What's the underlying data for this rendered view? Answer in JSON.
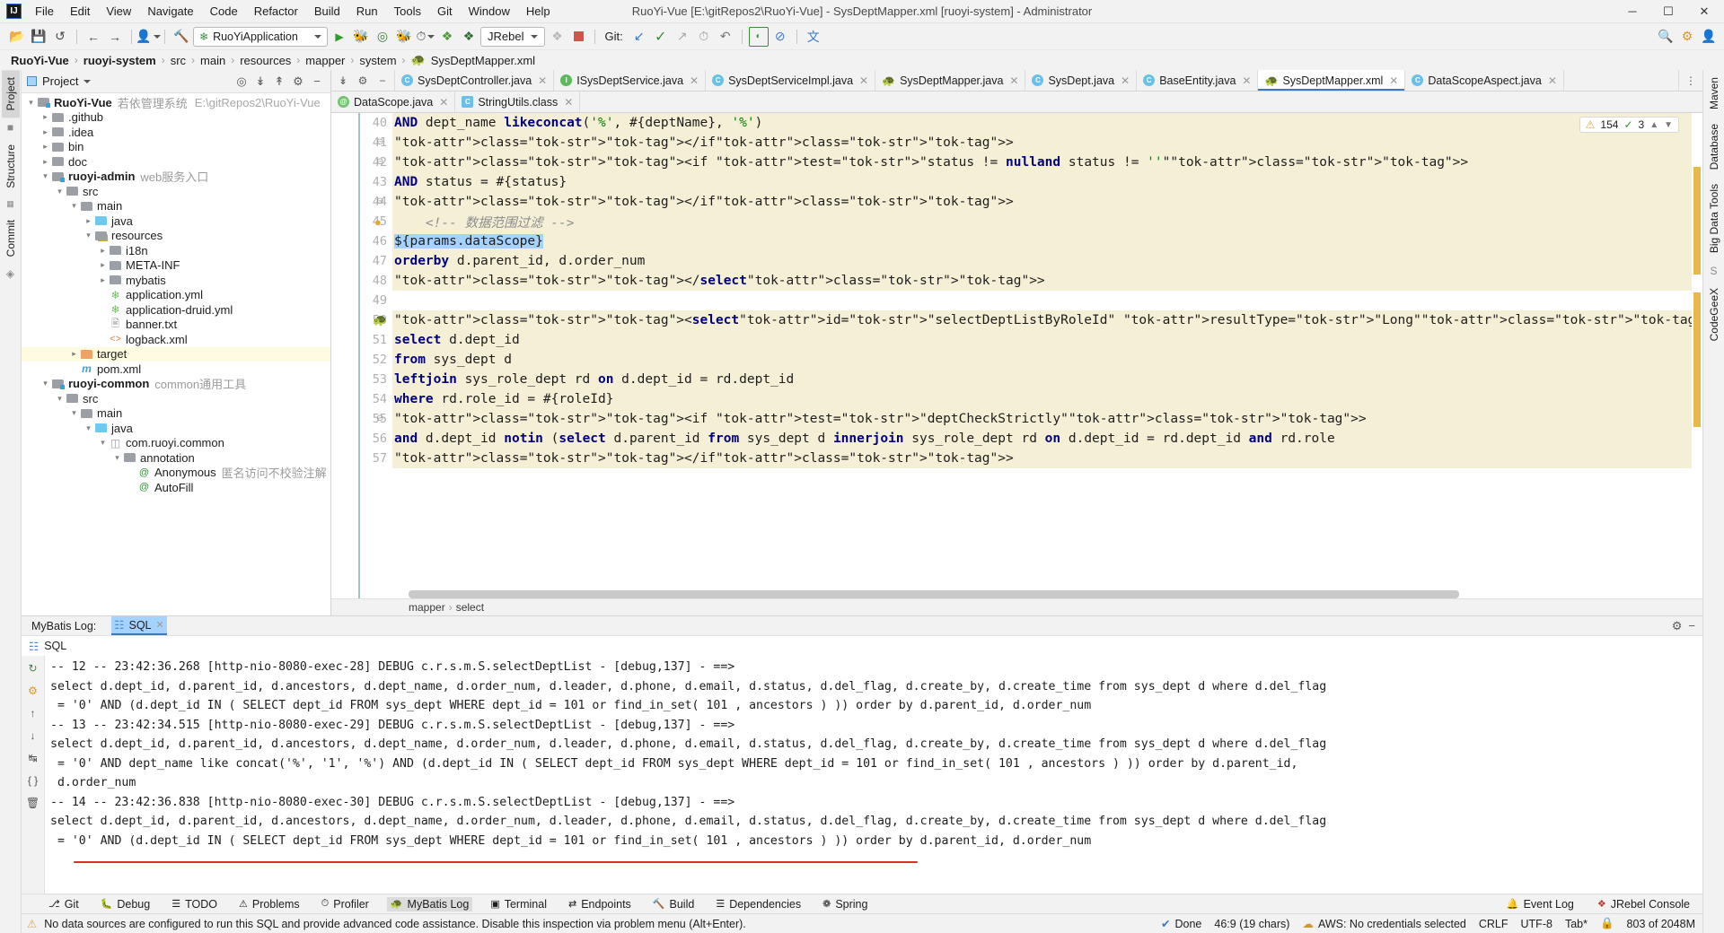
{
  "window": {
    "title": "RuoYi-Vue [E:\\gitRepos2\\RuoYi-Vue] - SysDeptMapper.xml [ruoyi-system] - Administrator",
    "minimize": "─",
    "maximize": "☐",
    "close": "✕",
    "logo": "IJ"
  },
  "menu": {
    "items": [
      "File",
      "Edit",
      "View",
      "Navigate",
      "Code",
      "Refactor",
      "Build",
      "Run",
      "Tools",
      "Git",
      "Window",
      "Help"
    ]
  },
  "toolbar": {
    "open_icon": "open-folder-icon",
    "save_icon": "save-icon",
    "sync_icon": "sync-icon",
    "back_icon": "back-arrow-icon",
    "forward_icon": "forward-arrow-icon",
    "profile_icon": "user-icon",
    "build_icon": "hammer-icon",
    "run_config": "RuoYiApplication",
    "run_icon": "run-icon",
    "debug_icon": "debug-icon",
    "coverage_icon": "run-with-coverage-icon",
    "profiler_icon": "profiler-icon",
    "jrebel_run_icon": "jrebel-run-icon",
    "jrebel_debug_icon": "jrebel-debug-icon",
    "jrebel_label": "JRebel",
    "stop_icon": "stop-icon",
    "git_label": "Git:",
    "git_update_icon": "update-project-icon",
    "git_commit_icon": "commit-icon",
    "git_push_icon": "push-icon",
    "git_history_icon": "history-icon",
    "git_rollback_icon": "rollback-icon",
    "search_everywhere_icon": "monitor-icon",
    "block_icon": "no-entry-icon",
    "translate_icon": "translate-icon",
    "right_search_icon": "search-icon",
    "right_settings_icon": "gear-icon",
    "right_account_icon": "account-icon"
  },
  "breadcrumb": {
    "items": [
      "RuoYi-Vue",
      "ruoyi-system",
      "src",
      "main",
      "resources",
      "mapper",
      "system",
      "SysDeptMapper.xml"
    ],
    "separator": "›"
  },
  "left_toolbar": {
    "tabs": [
      "Project",
      "Structure",
      "Commit"
    ]
  },
  "right_toolbar": {
    "tabs": [
      "Maven",
      "Database",
      "Big Data Tools",
      "CodeGeeX"
    ]
  },
  "project_panel": {
    "title": "Project",
    "actions": [
      "locate-icon",
      "expand-all-icon",
      "collapse-all-icon",
      "settings-icon",
      "hide-icon"
    ],
    "tree": [
      {
        "depth": 0,
        "arrow": "v",
        "icon": "module",
        "label": "RuoYi-Vue",
        "bold": true,
        "note": "若依管理系统",
        "path": "E:\\gitRepos2\\RuoYi-Vue",
        "hl": false
      },
      {
        "depth": 1,
        "arrow": ">",
        "icon": "folder",
        "label": ".github",
        "bold": false,
        "note": "",
        "path": "",
        "hl": false
      },
      {
        "depth": 1,
        "arrow": ">",
        "icon": "folder",
        "label": ".idea",
        "bold": false,
        "note": "",
        "path": "",
        "hl": false
      },
      {
        "depth": 1,
        "arrow": ">",
        "icon": "folder",
        "label": "bin",
        "bold": false,
        "note": "",
        "path": "",
        "hl": false
      },
      {
        "depth": 1,
        "arrow": ">",
        "icon": "folder",
        "label": "doc",
        "bold": false,
        "note": "",
        "path": "",
        "hl": false
      },
      {
        "depth": 1,
        "arrow": "v",
        "icon": "module",
        "label": "ruoyi-admin",
        "bold": true,
        "note": "web服务入口",
        "path": "",
        "hl": false
      },
      {
        "depth": 2,
        "arrow": "v",
        "icon": "folder",
        "label": "src",
        "bold": false,
        "note": "",
        "path": "",
        "hl": false
      },
      {
        "depth": 3,
        "arrow": "v",
        "icon": "folder",
        "label": "main",
        "bold": false,
        "note": "",
        "path": "",
        "hl": false
      },
      {
        "depth": 4,
        "arrow": ">",
        "icon": "folder-blue",
        "label": "java",
        "bold": false,
        "note": "",
        "path": "",
        "hl": false
      },
      {
        "depth": 4,
        "arrow": "v",
        "icon": "folder-res",
        "label": "resources",
        "bold": false,
        "note": "",
        "path": "",
        "hl": false
      },
      {
        "depth": 5,
        "arrow": ">",
        "icon": "folder",
        "label": "i18n",
        "bold": false,
        "note": "",
        "path": "",
        "hl": false
      },
      {
        "depth": 5,
        "arrow": ">",
        "icon": "folder",
        "label": "META-INF",
        "bold": false,
        "note": "",
        "path": "",
        "hl": false
      },
      {
        "depth": 5,
        "arrow": ">",
        "icon": "folder",
        "label": "mybatis",
        "bold": false,
        "note": "",
        "path": "",
        "hl": false
      },
      {
        "depth": 5,
        "arrow": "",
        "icon": "yml",
        "label": "application.yml",
        "bold": false,
        "note": "",
        "path": "",
        "hl": false
      },
      {
        "depth": 5,
        "arrow": "",
        "icon": "yml",
        "label": "application-druid.yml",
        "bold": false,
        "note": "",
        "path": "",
        "hl": false
      },
      {
        "depth": 5,
        "arrow": "",
        "icon": "txt",
        "label": "banner.txt",
        "bold": false,
        "note": "",
        "path": "",
        "hl": false
      },
      {
        "depth": 5,
        "arrow": "",
        "icon": "xml",
        "label": "logback.xml",
        "bold": false,
        "note": "",
        "path": "",
        "hl": false
      },
      {
        "depth": 3,
        "arrow": ">",
        "icon": "folder-orange",
        "label": "target",
        "bold": false,
        "note": "",
        "path": "",
        "hl": true
      },
      {
        "depth": 3,
        "arrow": "",
        "icon": "maven",
        "label": "pom.xml",
        "bold": false,
        "note": "",
        "path": "",
        "hl": false
      },
      {
        "depth": 1,
        "arrow": "v",
        "icon": "module",
        "label": "ruoyi-common",
        "bold": true,
        "note": "common通用工具",
        "path": "",
        "hl": false
      },
      {
        "depth": 2,
        "arrow": "v",
        "icon": "folder",
        "label": "src",
        "bold": false,
        "note": "",
        "path": "",
        "hl": false
      },
      {
        "depth": 3,
        "arrow": "v",
        "icon": "folder",
        "label": "main",
        "bold": false,
        "note": "",
        "path": "",
        "hl": false
      },
      {
        "depth": 4,
        "arrow": "v",
        "icon": "folder-blue",
        "label": "java",
        "bold": false,
        "note": "",
        "path": "",
        "hl": false
      },
      {
        "depth": 5,
        "arrow": "v",
        "icon": "package",
        "label": "com.ruoyi.common",
        "bold": false,
        "note": "",
        "path": "",
        "hl": false
      },
      {
        "depth": 6,
        "arrow": "v",
        "icon": "folder",
        "label": "annotation",
        "bold": false,
        "note": "",
        "path": "",
        "hl": false
      },
      {
        "depth": 7,
        "arrow": "",
        "icon": "annot",
        "label": "Anonymous",
        "bold": false,
        "note": "匿名访问不校验注解 @ ruoyi",
        "path": "",
        "hl": false
      },
      {
        "depth": 7,
        "arrow": "",
        "icon": "annot",
        "label": "AutoFill",
        "bold": false,
        "note": "",
        "path": "",
        "hl": false
      }
    ]
  },
  "editor": {
    "tabs_row1": [
      {
        "label": "SysDeptController.java",
        "icon": "class",
        "active": false
      },
      {
        "label": "ISysDeptService.java",
        "icon": "interface",
        "active": false
      },
      {
        "label": "SysDeptServiceImpl.java",
        "icon": "class",
        "active": false
      },
      {
        "label": "SysDeptMapper.java",
        "icon": "mybatis",
        "active": false
      },
      {
        "label": "SysDept.java",
        "icon": "class",
        "active": false
      },
      {
        "label": "BaseEntity.java",
        "icon": "class",
        "active": false
      },
      {
        "label": "SysDeptMapper.xml",
        "icon": "mybatis",
        "active": true
      },
      {
        "label": "DataScopeAspect.java",
        "icon": "class",
        "active": false
      }
    ],
    "tabs_row2": [
      {
        "label": "DataScope.java",
        "icon": "annotation",
        "active": false
      },
      {
        "label": "StringUtils.class",
        "icon": "class-file",
        "active": false
      }
    ],
    "tools": [
      "collapse-icon",
      "gear-icon",
      "hide-icon"
    ],
    "overflow_icon": "more-tabs-icon",
    "inspection": {
      "warnings": "154",
      "checks": "3",
      "warn_icon": "warning-triangle-icon",
      "ok_icon": "check-icon",
      "up_icon": "chevron-up-icon",
      "down_icon": "chevron-down-icon"
    },
    "lines": [
      {
        "num": "40",
        "fold": "",
        "text": "        AND dept_name like concat('%', #{deptName}, '%')",
        "hl": true
      },
      {
        "num": "41",
        "fold": "-",
        "text": "    </if>",
        "hl": true
      },
      {
        "num": "42",
        "fold": "-",
        "text": "    <if test=\"status != null and status != ''\">",
        "hl": true
      },
      {
        "num": "43",
        "fold": "",
        "text": "        AND status = #{status}",
        "hl": true
      },
      {
        "num": "44",
        "fold": "-",
        "text": "    </if>",
        "hl": true
      },
      {
        "num": "45",
        "fold": "",
        "text": "    <!-- 数据范围过滤 -->",
        "hl": true
      },
      {
        "num": "46",
        "fold": "",
        "text": "    ${params.dataScope}",
        "hl": true
      },
      {
        "num": "47",
        "fold": "",
        "text": "    order by d.parent_id, d.order_num",
        "hl": true
      },
      {
        "num": "48",
        "fold": "",
        "text": "</select>",
        "hl": true
      },
      {
        "num": "49",
        "fold": "",
        "text": "",
        "hl": false
      },
      {
        "num": "50",
        "fold": "",
        "text": "<select id=\"selectDeptListByRoleId\" resultType=\"Long\">",
        "hl": true
      },
      {
        "num": "51",
        "fold": "",
        "text": "    select d.dept_id",
        "hl": true
      },
      {
        "num": "52",
        "fold": "",
        "text": "    from sys_dept d",
        "hl": true
      },
      {
        "num": "53",
        "fold": "",
        "text": "        left join sys_role_dept rd on d.dept_id = rd.dept_id",
        "hl": true
      },
      {
        "num": "54",
        "fold": "",
        "text": "    where rd.role_id = #{roleId}",
        "hl": true
      },
      {
        "num": "55",
        "fold": "-",
        "text": "        <if test=\"deptCheckStrictly\">",
        "hl": true
      },
      {
        "num": "56",
        "fold": "",
        "text": "          and d.dept_id not in (select d.parent_id from sys_dept d inner join sys_role_dept rd on d.dept_id = rd.dept_id and rd.role",
        "hl": true
      },
      {
        "num": "57",
        "fold": "",
        "text": "        </if>",
        "hl": true
      }
    ],
    "breadcrumb2": [
      "mapper",
      "select"
    ],
    "bulb_icon": "intention-bulb-icon",
    "mybatis_gutter_icon": "mybatis-statement-icon"
  },
  "bottom_panel": {
    "tabs": [
      {
        "label": "MyBatis Log:",
        "sel": false,
        "icon": ""
      },
      {
        "label": "SQL",
        "sel": true,
        "icon": "sql-tab-icon",
        "close": "✕"
      }
    ],
    "right_icons": [
      "settings-icon",
      "hide-icon"
    ],
    "sql_label": "SQL",
    "sql_icon": "sql-icon",
    "side_buttons": [
      "rerun-icon",
      "settings-icon",
      "up-icon",
      "down-icon",
      "wrap-icon",
      "braces-icon",
      "trash-icon"
    ],
    "console_lines": [
      "-- 12 -- 23:42:36.268 [http-nio-8080-exec-28] DEBUG c.r.s.m.S.selectDeptList - [debug,137] - ==>",
      "select d.dept_id, d.parent_id, d.ancestors, d.dept_name, d.order_num, d.leader, d.phone, d.email, d.status, d.del_flag, d.create_by, d.create_time from sys_dept d where d.del_flag",
      " = '0' AND (d.dept_id IN ( SELECT dept_id FROM sys_dept WHERE dept_id = 101 or find_in_set( 101 , ancestors ) )) order by d.parent_id, d.order_num",
      "-- 13 -- 23:42:34.515 [http-nio-8080-exec-29] DEBUG c.r.s.m.S.selectDeptList - [debug,137] - ==>",
      "select d.dept_id, d.parent_id, d.ancestors, d.dept_name, d.order_num, d.leader, d.phone, d.email, d.status, d.del_flag, d.create_by, d.create_time from sys_dept d where d.del_flag",
      " = '0' AND dept_name like concat('%', '1', '%') AND (d.dept_id IN ( SELECT dept_id FROM sys_dept WHERE dept_id = 101 or find_in_set( 101 , ancestors ) )) order by d.parent_id,",
      " d.order_num",
      "-- 14 -- 23:42:36.838 [http-nio-8080-exec-30] DEBUG c.r.s.m.S.selectDeptList - [debug,137] - ==>",
      "select d.dept_id, d.parent_id, d.ancestors, d.dept_name, d.order_num, d.leader, d.phone, d.email, d.status, d.del_flag, d.create_by, d.create_time from sys_dept d where d.del_flag",
      " = '0' AND (d.dept_id IN ( SELECT dept_id FROM sys_dept WHERE dept_id = 101 or find_in_set( 101 , ancestors ) )) order by d.parent_id, d.order_num"
    ]
  },
  "status_tabs": {
    "left": [
      {
        "label": "Git",
        "icon": "git-icon",
        "sel": false
      },
      {
        "label": "Debug",
        "icon": "debug-icon",
        "sel": false
      },
      {
        "label": "TODO",
        "icon": "todo-icon",
        "sel": false
      },
      {
        "label": "Problems",
        "icon": "problems-icon",
        "sel": false
      },
      {
        "label": "Profiler",
        "icon": "profiler-icon",
        "sel": false
      },
      {
        "label": "MyBatis Log",
        "icon": "mybatis-icon",
        "sel": true
      },
      {
        "label": "Terminal",
        "icon": "terminal-icon",
        "sel": false
      },
      {
        "label": "Endpoints",
        "icon": "endpoints-icon",
        "sel": false
      },
      {
        "label": "Build",
        "icon": "build-icon",
        "sel": false
      },
      {
        "label": "Dependencies",
        "icon": "dependencies-icon",
        "sel": false
      },
      {
        "label": "Spring",
        "icon": "spring-icon",
        "sel": false
      }
    ],
    "right": [
      {
        "label": "Event Log",
        "icon": "event-log-icon"
      },
      {
        "label": "JRebel Console",
        "icon": "jrebel-icon"
      }
    ]
  },
  "statusbar": {
    "message": "No data sources are configured to run this SQL and provide advanced code assistance. Disable this inspection via problem menu (Alt+Enter).",
    "warn_icon": "warning-triangle-icon",
    "done": "Done",
    "caret": "46:9 (19 chars)",
    "aws": "AWS: No credentials selected",
    "aws_icon": "aws-icon",
    "line_sep": "CRLF",
    "encoding": "UTF-8",
    "indent": "Tab*",
    "memory": "803 of 2048M",
    "lock_icon": "lock-icon",
    "done_icon": "check-circle-icon"
  }
}
